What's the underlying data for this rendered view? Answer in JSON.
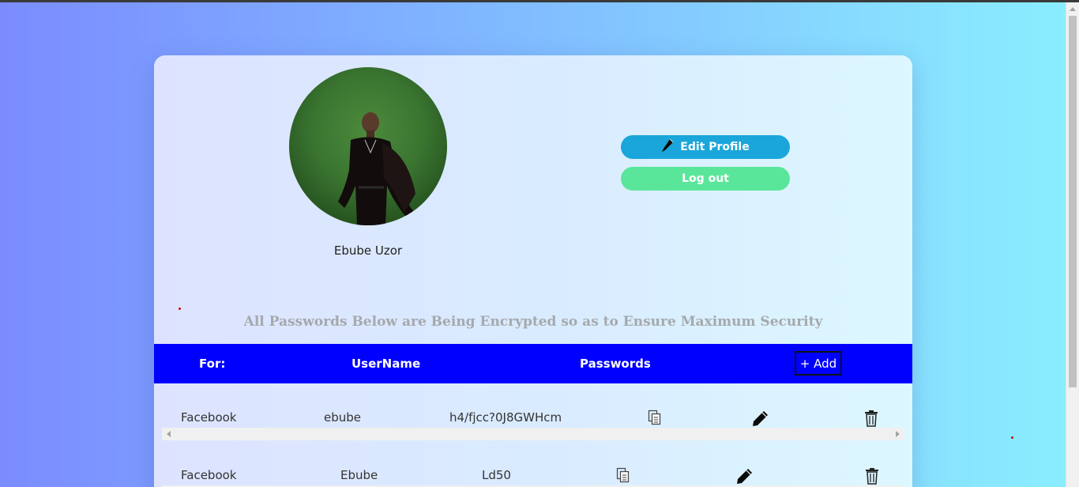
{
  "profile": {
    "name": "Ebube Uzor",
    "avatar_icon": "profile-photo"
  },
  "actions": {
    "edit_label": "Edit Profile",
    "logout_label": "Log out"
  },
  "notice": "All Passwords Below are Being Encrypted so as to Ensure Maximum Security",
  "table": {
    "headers": [
      "For:",
      "UserName",
      "Passwords"
    ],
    "add_label": "+ Add",
    "rows": [
      {
        "for": "Facebook",
        "username": "ebube",
        "password": "h4/fjcc?0J8GWHcm"
      },
      {
        "for": "Facebook",
        "username": "Ebube",
        "password": "Ld50"
      }
    ]
  },
  "colors": {
    "header_bg": "#0000ff",
    "edit_button": "#1aa6da",
    "logout_button": "#5ae69a",
    "notice_text": "#a5a9ad"
  },
  "icons": {
    "copy": "copy-icon",
    "edit": "pencil-icon",
    "delete": "trash-icon"
  }
}
